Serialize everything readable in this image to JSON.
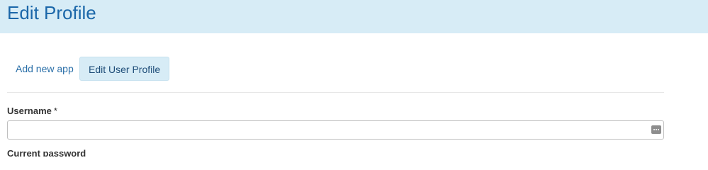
{
  "header": {
    "title": "Edit Profile"
  },
  "tabs": [
    {
      "label": "Add new app",
      "active": false
    },
    {
      "label": "Edit User Profile",
      "active": true
    }
  ],
  "form": {
    "username": {
      "label": "Username",
      "required_marker": "*",
      "value": "",
      "icon": "password-manager-icon"
    },
    "current_password": {
      "label": "Current password"
    }
  },
  "colors": {
    "header_bg": "#d7ecf6",
    "title": "#1b67a9",
    "link": "#2a6fa8"
  }
}
